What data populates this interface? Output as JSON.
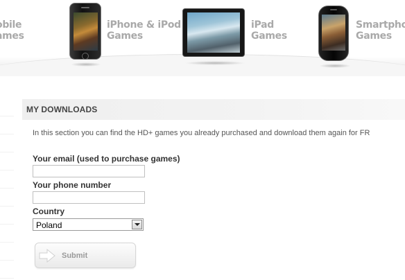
{
  "nav": {
    "items": [
      {
        "line1": "obile",
        "line2": "ames"
      },
      {
        "line1": "iPhone & iPod",
        "line2": "Games"
      },
      {
        "line1": "iPad",
        "line2": "Games"
      },
      {
        "line1": "Smartphone",
        "line2": "Games"
      }
    ]
  },
  "section": {
    "title": "MY DOWNLOADS",
    "intro": "In this section you can find the HD+ games you already purchased and download them again for FR"
  },
  "form": {
    "email_label": "Your email (used to purchase games)",
    "email_value": "",
    "phone_label": "Your phone number",
    "phone_value": "",
    "country_label": "Country",
    "country_value": "Poland",
    "submit_label": "Submit"
  },
  "colors": {
    "nav_text": "#a9a9a9",
    "header_bg": "#efefef",
    "label_text": "#333333"
  }
}
